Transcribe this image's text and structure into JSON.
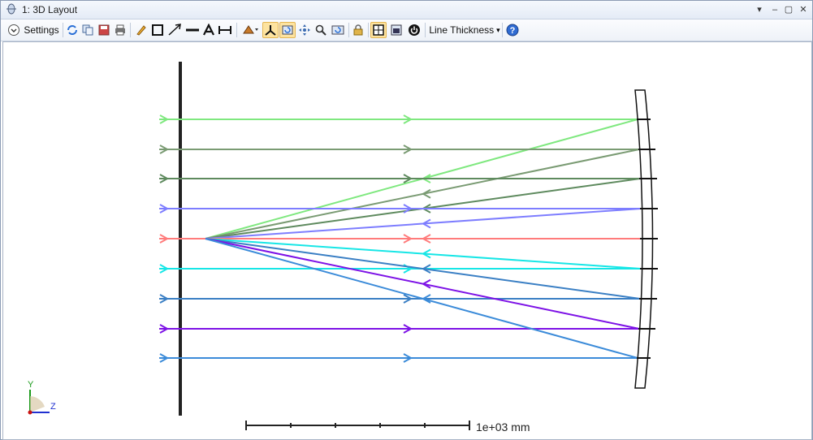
{
  "window": {
    "title": "1: 3D Layout"
  },
  "toolbar": {
    "settings_label": "Settings",
    "line_thickness_label": "Line Thickness",
    "icons": [
      "refresh-icon",
      "copy-icon",
      "save-icon",
      "print-icon",
      "pencil-icon",
      "rectangle-icon",
      "arrow-icon",
      "line-icon",
      "text-icon",
      "dimension-icon",
      "rotate-icon",
      "axes-icon",
      "reset-icon",
      "pan-icon",
      "zoom-icon",
      "fit-icon",
      "lock-icon",
      "layout-icon",
      "window-icon",
      "power-icon",
      "help-icon"
    ]
  },
  "layout": {
    "scale_label": "1e+03 mm",
    "axes": {
      "y_label": "Y",
      "z_label": "Z"
    },
    "ray_colors": [
      "#7fe87f",
      "#7a9b73",
      "#5e8a5e",
      "#7d7dff",
      "#ff7b7b",
      "#17e6e6",
      "#3a7fc4",
      "#7d12e6",
      "#3b8bd9"
    ]
  }
}
